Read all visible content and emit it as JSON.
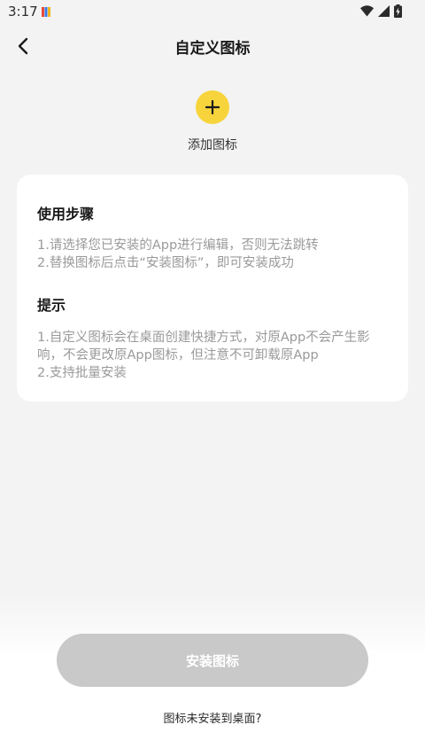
{
  "status_bar": {
    "time": "3:17",
    "icons": [
      "wifi-icon",
      "cellular-signal-icon",
      "battery-charging-icon"
    ]
  },
  "header": {
    "back_icon": "chevron-left-icon",
    "title": "自定义图标"
  },
  "add_icon": {
    "icon": "plus-icon",
    "label": "添加图标",
    "accent_color": "#f7d43c"
  },
  "card": {
    "steps": {
      "heading": "使用步骤",
      "lines": [
        "1.请选择您已安装的App进行编辑，否则无法跳转",
        "2.替换图标后点击“安装图标”，即可安装成功"
      ]
    },
    "tips": {
      "heading": "提示",
      "lines": [
        "1.自定义图标会在桌面创建快捷方式，对原App不会产生影",
        "响，不会更改原App图标，但注意不可卸载原App",
        "2.支持批量安装"
      ]
    }
  },
  "footer": {
    "install_button": "安装图标",
    "install_button_color": "#c9c9c9",
    "help_link": "图标未安装到桌面?"
  }
}
